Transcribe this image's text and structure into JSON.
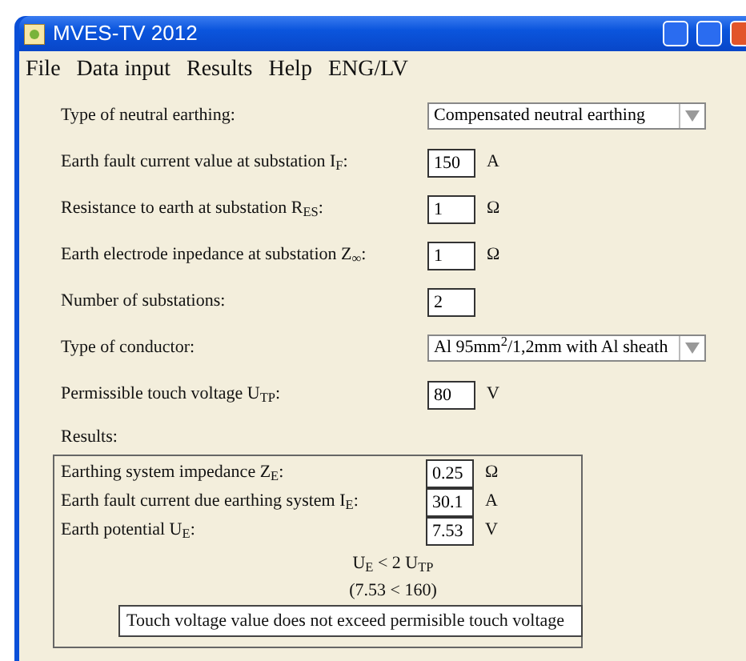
{
  "window": {
    "title": "MVES-TV 2012"
  },
  "menu": [
    "File",
    "Data input",
    "Results",
    "Help",
    "ENG/LV"
  ],
  "inputs": [
    {
      "kind": "select",
      "label": "Type of neutral earthing:",
      "value": "Compensated neutral earthing"
    },
    {
      "kind": "text",
      "label": "Earth fault current value at substation I$_{F}$:",
      "value": "150",
      "unit": "A"
    },
    {
      "kind": "text",
      "label": "Resistance to earth at substation R$_{ES}$:",
      "value": "1",
      "unit": "Ω"
    },
    {
      "kind": "text",
      "label": "Earth electrode inpedance at substation Z$_{∞}$:",
      "value": "1",
      "unit": "Ω"
    },
    {
      "kind": "text",
      "label": "Number of substations:",
      "value": "2"
    },
    {
      "kind": "select",
      "label": "Type of conductor:",
      "value": "Al 95mm$^{2}$/1,2mm with Al sheath"
    },
    {
      "kind": "text",
      "label": "Permissible touch voltage U$_{TP}$:",
      "value": "80",
      "unit": "V"
    }
  ],
  "results": {
    "title": "Results:",
    "rows": [
      {
        "label": "Earthing system impedance Z$_{E}$:",
        "value": "0.25",
        "unit": "Ω"
      },
      {
        "label": "Earth fault current due earthing system I$_{E}$:",
        "value": "30.1",
        "unit": "A"
      },
      {
        "label": "Earth potential U$_{E}$:",
        "value": "7.53",
        "unit": "V"
      }
    ],
    "condition": "U$_{E}$ < 2 U$_{TP}$",
    "comparison": "(7.53 < 160)",
    "message": "Touch voltage value does not exceed permisible touch voltage"
  }
}
